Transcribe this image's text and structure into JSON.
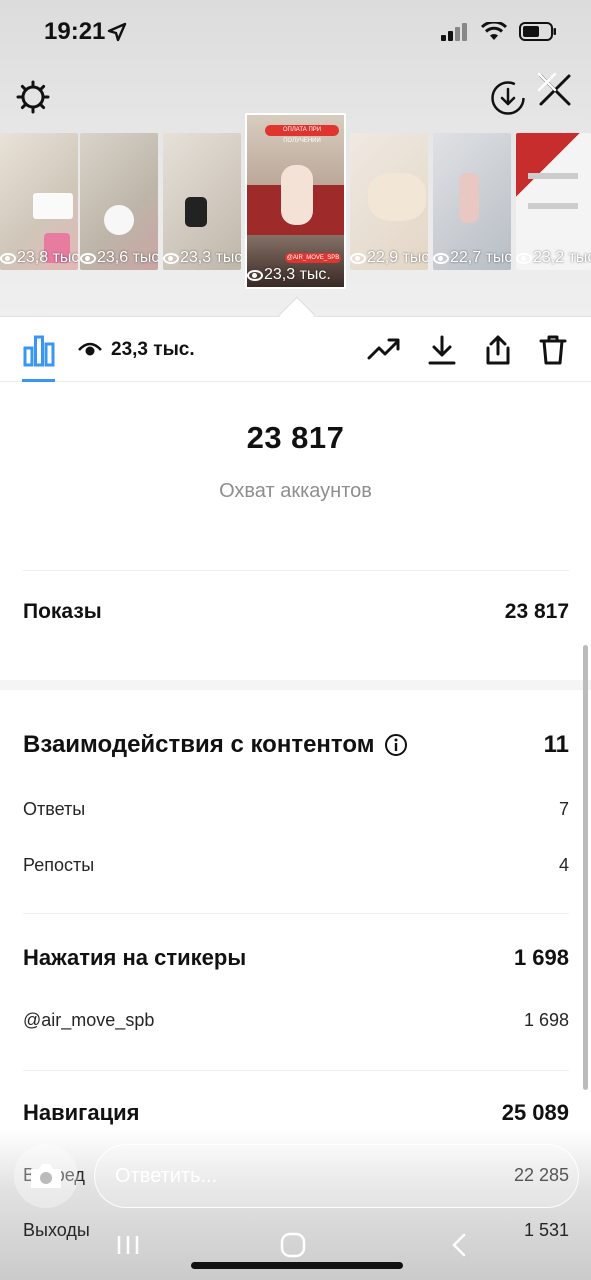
{
  "status": {
    "time": "19:21"
  },
  "thumbs": [
    {
      "views": "23,8 тыс."
    },
    {
      "views": "23,6 тыс."
    },
    {
      "views": "23,3 тыс."
    },
    {
      "views": "23,3 тыс.",
      "banner": "ОПЛАТА ПРИ ПОЛУЧЕНИИ",
      "tag": "@AIR_MOVE_SPB"
    },
    {
      "views": "22,9 тыс."
    },
    {
      "views": "22,7 тыс."
    },
    {
      "views": "23,2 тыс."
    }
  ],
  "toolbar": {
    "views": "23,3 тыс."
  },
  "reach": {
    "value": "23 817",
    "label": "Охват аккаунтов"
  },
  "impressions": {
    "label": "Показы",
    "value": "23 817"
  },
  "interactions": {
    "label": "Взаимодействия с контентом",
    "value": "11",
    "rows": [
      {
        "label": "Ответы",
        "value": "7"
      },
      {
        "label": "Репосты",
        "value": "4"
      }
    ]
  },
  "stickers": {
    "label": "Нажатия на стикеры",
    "value": "1 698",
    "rows": [
      {
        "label": "@air_move_spb",
        "value": "1 698"
      }
    ]
  },
  "navigation": {
    "label": "Навигация",
    "value": "25 089",
    "rows": [
      {
        "label": "Вперед",
        "value": "22 285"
      },
      {
        "label": "Выходы",
        "value": "1 531"
      }
    ]
  },
  "reply": {
    "placeholder": "Ответить..."
  },
  "colors": {
    "accent": "#3897f0"
  }
}
